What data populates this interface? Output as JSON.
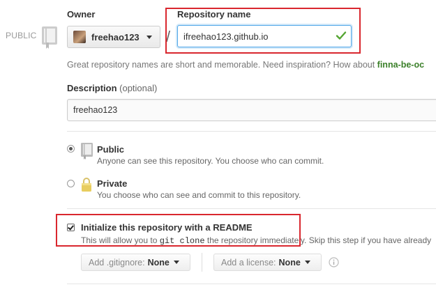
{
  "visibility_badge": "PUBLIC",
  "owner": {
    "label": "Owner",
    "name": "freehao123"
  },
  "repo": {
    "label": "Repository name",
    "value": "ifreehao123.github.io",
    "separator": "/"
  },
  "hint": {
    "text": "Great repository names are short and memorable. Need inspiration? How about ",
    "suggestion": "finna-be-oc"
  },
  "description": {
    "label": "Description",
    "optional": "(optional)",
    "value": "freehao123"
  },
  "visibility": {
    "public": {
      "title": "Public",
      "desc": "Anyone can see this repository. You choose who can commit.",
      "selected": true
    },
    "private": {
      "title": "Private",
      "desc": "You choose who can see and commit to this repository.",
      "selected": false
    }
  },
  "readme": {
    "title": "Initialize this repository with a README",
    "desc_pre": "This will allow you to ",
    "desc_code": "git clone",
    "desc_post": " the repository immediately. Skip this step if you have already",
    "checked": true
  },
  "gitignore": {
    "label": "Add .gitignore:",
    "value": "None"
  },
  "license": {
    "label": "Add a license:",
    "value": "None"
  },
  "colors": {
    "highlight": "#d9272e",
    "check": "#55a532",
    "suggestion": "#3a7f28",
    "focus": "#51a7e8"
  },
  "icons": [
    "repo-book-icon",
    "check-icon",
    "lock-icon",
    "caret-down-icon",
    "info-icon"
  ]
}
